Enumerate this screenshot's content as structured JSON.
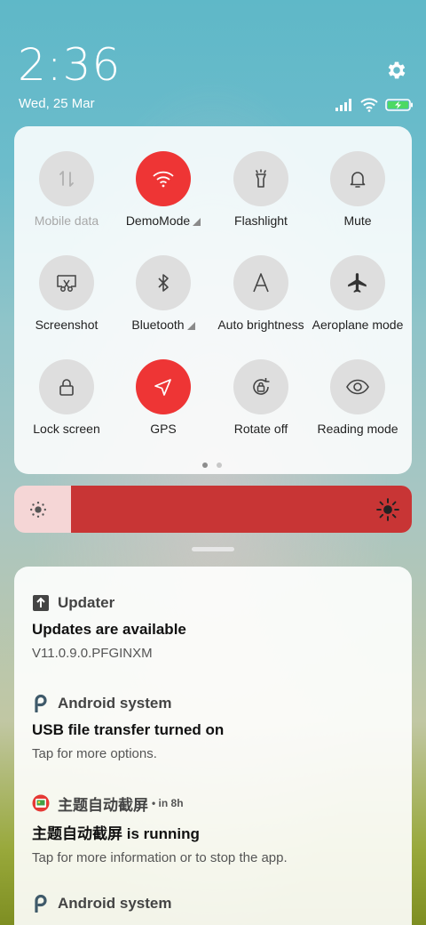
{
  "status_bar": {
    "time": "2:36",
    "date": "Wed, 25 Mar",
    "icons": [
      "signal-icon",
      "wifi-icon",
      "battery-charging-icon"
    ]
  },
  "quick_settings": {
    "tiles": [
      {
        "label": "Mobile data",
        "icon": "mobile-data-icon",
        "active": false,
        "disabled": true,
        "expand": false
      },
      {
        "label": "DemoMode",
        "icon": "wifi-icon",
        "active": true,
        "disabled": false,
        "expand": true
      },
      {
        "label": "Flashlight",
        "icon": "flashlight-icon",
        "active": false,
        "disabled": false,
        "expand": false
      },
      {
        "label": "Mute",
        "icon": "bell-icon",
        "active": false,
        "disabled": false,
        "expand": false
      },
      {
        "label": "Screenshot",
        "icon": "screenshot-icon",
        "active": false,
        "disabled": false,
        "expand": false
      },
      {
        "label": "Bluetooth",
        "icon": "bluetooth-icon",
        "active": false,
        "disabled": false,
        "expand": true
      },
      {
        "label": "Auto brightness",
        "icon": "auto-brightness-icon",
        "active": false,
        "disabled": false,
        "expand": false
      },
      {
        "label": "Aeroplane mode",
        "icon": "airplane-icon",
        "active": false,
        "disabled": false,
        "expand": false
      },
      {
        "label": "Lock screen",
        "icon": "lock-icon",
        "active": false,
        "disabled": false,
        "expand": false
      },
      {
        "label": "GPS",
        "icon": "location-arrow-icon",
        "active": true,
        "disabled": false,
        "expand": false
      },
      {
        "label": "Rotate off",
        "icon": "rotation-lock-icon",
        "active": false,
        "disabled": false,
        "expand": false
      },
      {
        "label": "Reading mode",
        "icon": "eye-icon",
        "active": false,
        "disabled": false,
        "expand": false
      }
    ],
    "page_indicator": {
      "pages": 2,
      "current": 1
    }
  },
  "brightness": {
    "level": 0.9
  },
  "notifications": [
    {
      "app": "Updater",
      "icon": "upload-arrow-icon",
      "time": "",
      "title": "Updates are available",
      "body": "V11.0.9.0.PFGINXM"
    },
    {
      "app": "Android system",
      "icon": "android-system-icon",
      "time": "",
      "title": "USB file transfer turned on",
      "body": "Tap for more options."
    },
    {
      "app": "主题自动截屏",
      "icon": "theme-app-icon",
      "time": "• in 8h",
      "title": "主题自动截屏 is running",
      "body": "Tap for more information or to stop the app."
    },
    {
      "app": "Android system",
      "icon": "android-system-icon",
      "time": "",
      "title": "",
      "body": ""
    }
  ],
  "colors": {
    "accent": "#ee3535",
    "brightness_fill": "#c83535",
    "brightness_track": "#f5d6d6"
  }
}
